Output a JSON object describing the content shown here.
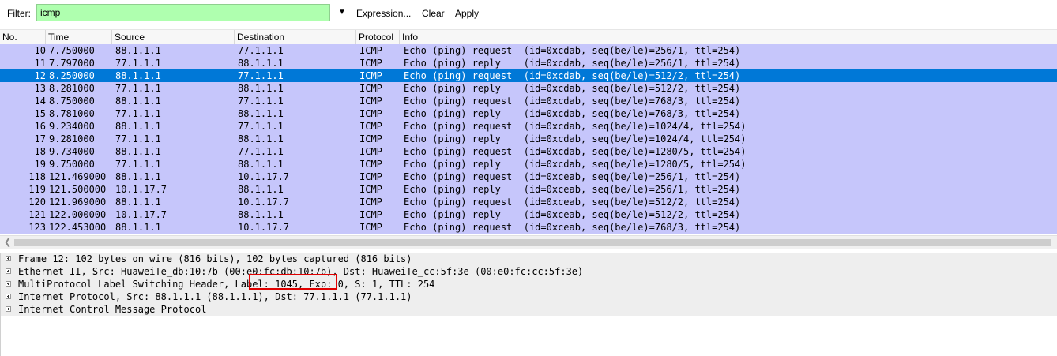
{
  "filter": {
    "label": "Filter:",
    "value": "icmp",
    "expression_label": "Expression...",
    "clear_label": "Clear",
    "apply_label": "Apply"
  },
  "columns": [
    "No.",
    "Time",
    "Source",
    "Destination",
    "Protocol",
    "Info"
  ],
  "packets": [
    {
      "no": "10",
      "time": "7.750000",
      "src": "88.1.1.1",
      "dst": "77.1.1.1",
      "proto": "ICMP",
      "info": "Echo (ping) request  (id=0xcdab, seq(be/le)=256/1, ttl=254)"
    },
    {
      "no": "11",
      "time": "7.797000",
      "src": "77.1.1.1",
      "dst": "88.1.1.1",
      "proto": "ICMP",
      "info": "Echo (ping) reply    (id=0xcdab, seq(be/le)=256/1, ttl=254)"
    },
    {
      "no": "12",
      "time": "8.250000",
      "src": "88.1.1.1",
      "dst": "77.1.1.1",
      "proto": "ICMP",
      "info": "Echo (ping) request  (id=0xcdab, seq(be/le)=512/2, ttl=254)"
    },
    {
      "no": "13",
      "time": "8.281000",
      "src": "77.1.1.1",
      "dst": "88.1.1.1",
      "proto": "ICMP",
      "info": "Echo (ping) reply    (id=0xcdab, seq(be/le)=512/2, ttl=254)"
    },
    {
      "no": "14",
      "time": "8.750000",
      "src": "88.1.1.1",
      "dst": "77.1.1.1",
      "proto": "ICMP",
      "info": "Echo (ping) request  (id=0xcdab, seq(be/le)=768/3, ttl=254)"
    },
    {
      "no": "15",
      "time": "8.781000",
      "src": "77.1.1.1",
      "dst": "88.1.1.1",
      "proto": "ICMP",
      "info": "Echo (ping) reply    (id=0xcdab, seq(be/le)=768/3, ttl=254)"
    },
    {
      "no": "16",
      "time": "9.234000",
      "src": "88.1.1.1",
      "dst": "77.1.1.1",
      "proto": "ICMP",
      "info": "Echo (ping) request  (id=0xcdab, seq(be/le)=1024/4, ttl=254)"
    },
    {
      "no": "17",
      "time": "9.281000",
      "src": "77.1.1.1",
      "dst": "88.1.1.1",
      "proto": "ICMP",
      "info": "Echo (ping) reply    (id=0xcdab, seq(be/le)=1024/4, ttl=254)"
    },
    {
      "no": "18",
      "time": "9.734000",
      "src": "88.1.1.1",
      "dst": "77.1.1.1",
      "proto": "ICMP",
      "info": "Echo (ping) request  (id=0xcdab, seq(be/le)=1280/5, ttl=254)"
    },
    {
      "no": "19",
      "time": "9.750000",
      "src": "77.1.1.1",
      "dst": "88.1.1.1",
      "proto": "ICMP",
      "info": "Echo (ping) reply    (id=0xcdab, seq(be/le)=1280/5, ttl=254)"
    },
    {
      "no": "118",
      "time": "121.469000",
      "src": "88.1.1.1",
      "dst": "10.1.17.7",
      "proto": "ICMP",
      "info": "Echo (ping) request  (id=0xceab, seq(be/le)=256/1, ttl=254)"
    },
    {
      "no": "119",
      "time": "121.500000",
      "src": "10.1.17.7",
      "dst": "88.1.1.1",
      "proto": "ICMP",
      "info": "Echo (ping) reply    (id=0xceab, seq(be/le)=256/1, ttl=254)"
    },
    {
      "no": "120",
      "time": "121.969000",
      "src": "88.1.1.1",
      "dst": "10.1.17.7",
      "proto": "ICMP",
      "info": "Echo (ping) request  (id=0xceab, seq(be/le)=512/2, ttl=254)"
    },
    {
      "no": "121",
      "time": "122.000000",
      "src": "10.1.17.7",
      "dst": "88.1.1.1",
      "proto": "ICMP",
      "info": "Echo (ping) reply    (id=0xceab, seq(be/le)=512/2, ttl=254)"
    },
    {
      "no": "123",
      "time": "122.453000",
      "src": "88.1.1.1",
      "dst": "10.1.17.7",
      "proto": "ICMP",
      "info": "Echo (ping) request  (id=0xceab, seq(be/le)=768/3, ttl=254)"
    }
  ],
  "selected_packet_no": "12",
  "details": [
    "Frame 12: 102 bytes on wire (816 bits), 102 bytes captured (816 bits)",
    "Ethernet II, Src: HuaweiTe_db:10:7b (00:e0:fc:db:10:7b), Dst: HuaweiTe_cc:5f:3e (00:e0:fc:cc:5f:3e)",
    "MultiProtocol Label Switching Header, Label: 1045, Exp: 0, S: 1, TTL: 254",
    "Internet Protocol, Src: 88.1.1.1 (88.1.1.1), Dst: 77.1.1.1 (77.1.1.1)",
    "Internet Control Message Protocol"
  ],
  "colors": {
    "row_bg": "#c6c6fb",
    "selected_bg": "#0078d7",
    "filter_bg": "#afffaf",
    "highlight_box": "#e00000"
  }
}
